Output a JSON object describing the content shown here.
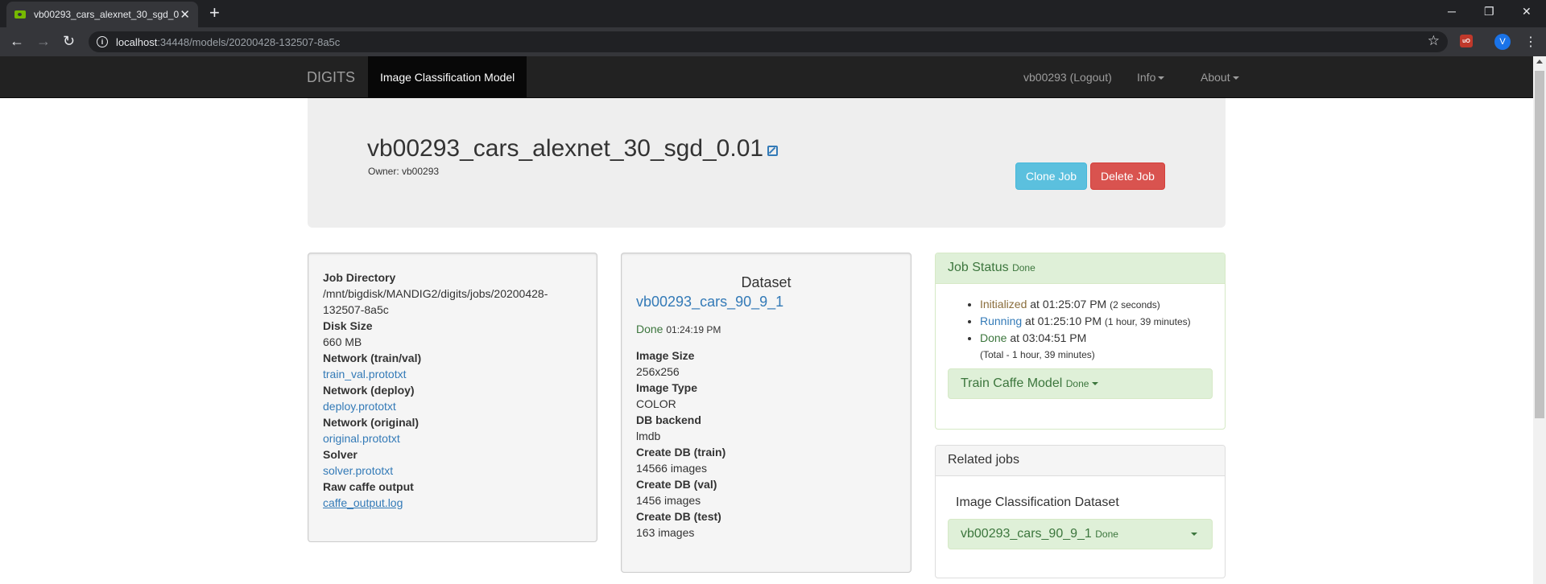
{
  "browser": {
    "tab_title": "vb00293_cars_alexnet_30_sgd_0.0",
    "tab_close": "✕",
    "new_tab": "+",
    "url_host": "localhost",
    "url_path": ":34448/models/20200428-132507-8a5c",
    "profile_initial": "V",
    "extension_label": "uO"
  },
  "navbar": {
    "brand": "DIGITS",
    "active": "Image Classification Model",
    "user": "vb00293 (Logout)",
    "info": "Info",
    "about": "About"
  },
  "header": {
    "title": "vb00293_cars_alexnet_30_sgd_0.01",
    "owner": "Owner: vb00293",
    "clone_label": "Clone Job",
    "delete_label": "Delete Job"
  },
  "job_info": {
    "job_dir_label": "Job Directory",
    "job_dir_line1": "/mnt/bigdisk/MANDIG2/digits/jobs/20200428-",
    "job_dir_line2": "132507-8a5c",
    "disk_size_label": "Disk Size",
    "disk_size": "660 MB",
    "net_trainval_label": "Network (train/val)",
    "net_trainval": "train_val.prototxt",
    "net_deploy_label": "Network (deploy)",
    "net_deploy": "deploy.prototxt",
    "net_original_label": "Network (original)",
    "net_original": "original.prototxt",
    "solver_label": "Solver",
    "solver": "solver.prototxt",
    "raw_label": "Raw caffe output",
    "raw": "caffe_output.log"
  },
  "dataset": {
    "heading": "Dataset",
    "name": "vb00293_cars_90_9_1",
    "status": "Done",
    "status_time": "01:24:19 PM",
    "image_size_label": "Image Size",
    "image_size": "256x256",
    "image_type_label": "Image Type",
    "image_type": "COLOR",
    "db_backend_label": "DB backend",
    "db_backend": "lmdb",
    "db_train_label": "Create DB (train)",
    "db_train": "14566 images",
    "db_val_label": "Create DB (val)",
    "db_val": "1456 images",
    "db_test_label": "Create DB (test)",
    "db_test": "163 images"
  },
  "job_status": {
    "title": "Job Status",
    "badge": "Done",
    "initialized": "Initialized",
    "initialized_at": " at 01:25:07 PM ",
    "initialized_dur": "(2 seconds)",
    "running": "Running",
    "running_at": " at 01:25:10 PM ",
    "running_dur": "(1 hour, 39 minutes)",
    "done": "Done",
    "done_at": " at 03:04:51 PM",
    "total": "(Total - 1 hour, 39 minutes)",
    "train_label": "Train Caffe Model",
    "train_badge": "Done"
  },
  "related": {
    "title": "Related jobs",
    "subtitle": "Image Classification Dataset",
    "item_label": "vb00293_cars_90_9_1",
    "item_badge": "Done"
  },
  "colors": {
    "navbar": "#222222",
    "primary_link": "#337ab7",
    "clone_button": "#5bc0de",
    "delete_button": "#d9534f",
    "success_bg": "#dff0d8",
    "success_text": "#3c763d"
  }
}
